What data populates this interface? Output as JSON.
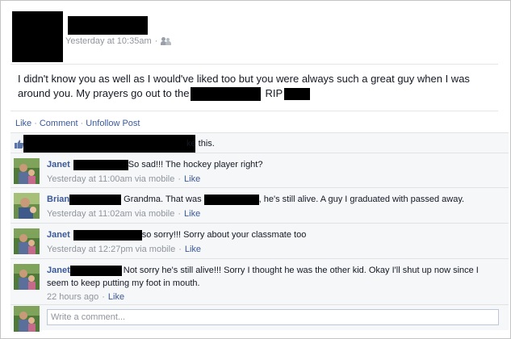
{
  "post": {
    "timestamp": "Yesterday at 10:35am",
    "separator": "·",
    "privacy_icon": "friends-icon",
    "text_line1": "I didn't know you as well as I would've liked too but you were always such a great guy when I was",
    "text_line2_start": "around you. My prayers go out to the",
    "text_line2_mid": "RIP"
  },
  "actions": {
    "like": "Like",
    "sep": "·",
    "comment": "Comment",
    "unfollow": "Unfollow Post"
  },
  "likes": {
    "icon": "thumbs-up-icon",
    "suffix": "ke this."
  },
  "comments": [
    {
      "author": "Janet",
      "text_after": "So sad!!! The hockey player right?",
      "meta_time": "Yesterday at 11:00am via mobile",
      "meta_sep": "·",
      "meta_like": "Like"
    },
    {
      "author": "Brian",
      "text_mid": " Grandma. That was ",
      "text_after": ", he's still alive. A guy I graduated with passed away.",
      "meta_time": "Yesterday at 11:02am via mobile",
      "meta_sep": "·",
      "meta_like": "Like"
    },
    {
      "author": "Janet",
      "text_after": "so sorry!!! Sorry about your classmate too",
      "meta_time": "Yesterday at 12:27pm via mobile",
      "meta_sep": "·",
      "meta_like": "Like"
    },
    {
      "author": "Janet",
      "text_after": "Not sorry he's still alive!!! Sorry I thought he was the other kid. Okay I'll shut up now since I",
      "text_line2": "seem to keep putting my foot in mouth.",
      "meta_time": "22 hours ago",
      "meta_sep": "·",
      "meta_like": "Like"
    }
  ],
  "composer": {
    "placeholder": "Write a comment..."
  },
  "colors": {
    "link": "#3b5998",
    "meta": "#90949c",
    "ufi_bg": "#f6f7f9"
  }
}
